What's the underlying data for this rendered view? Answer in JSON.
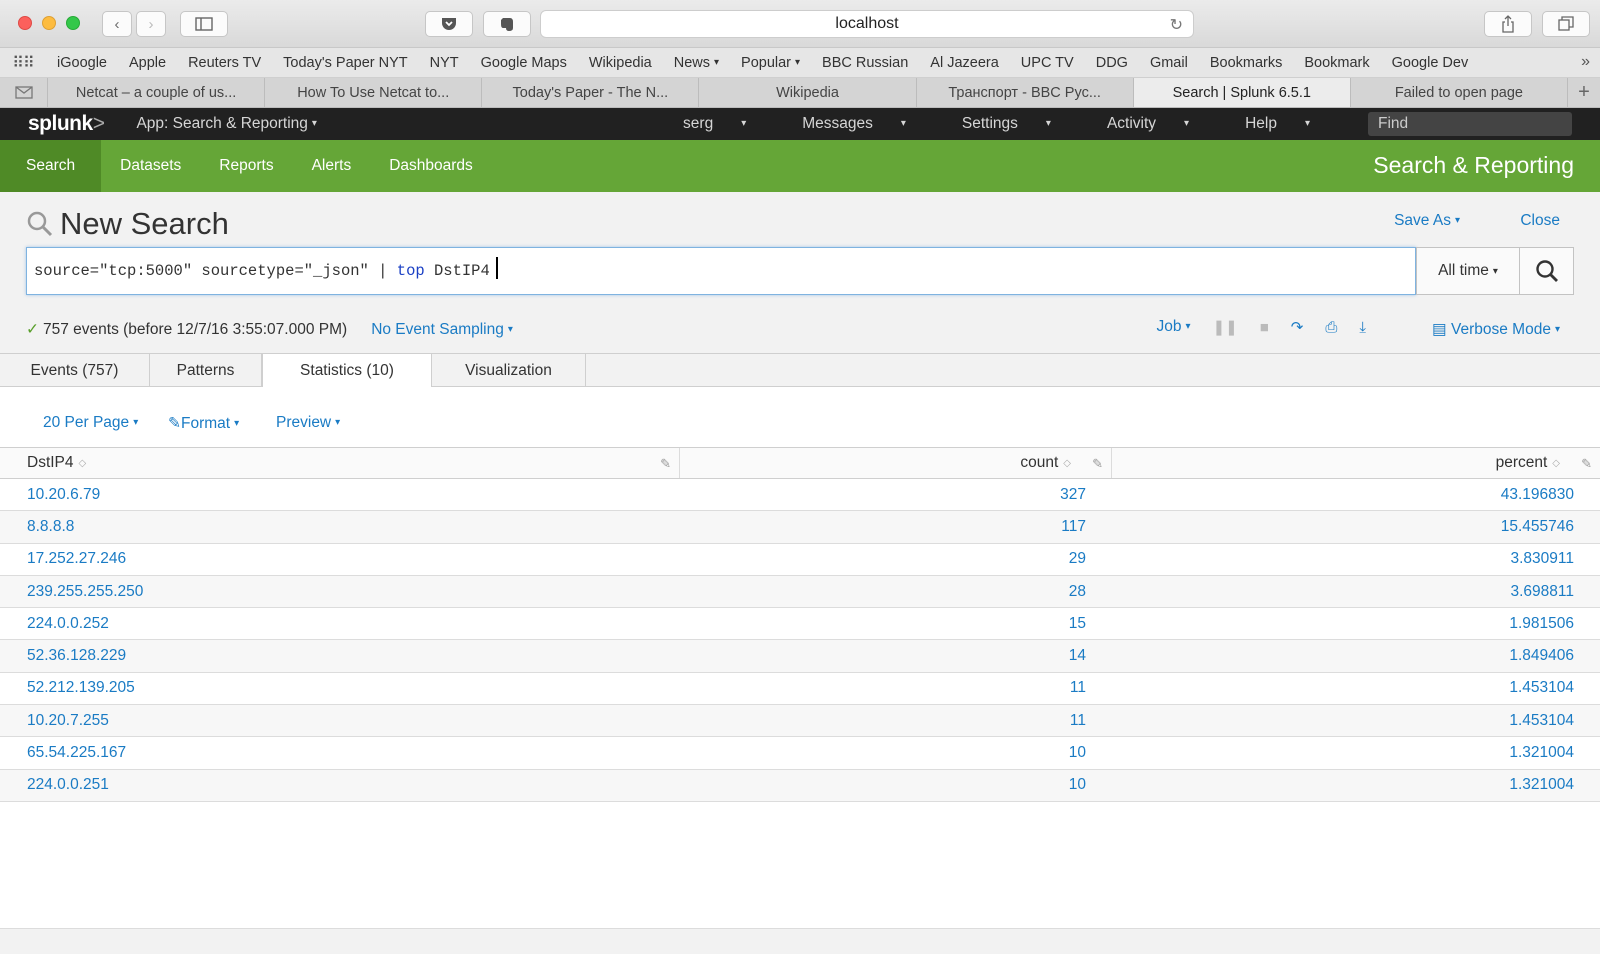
{
  "browser": {
    "url": "localhost",
    "bookmarks": [
      "iGoogle",
      "Apple",
      "Reuters TV",
      "Today's Paper NYT",
      "NYT",
      "Google Maps",
      "Wikipedia",
      "News",
      "Popular",
      "BBC Russian",
      "Al Jazeera",
      "UPC TV",
      "DDG",
      "Gmail",
      "Bookmarks",
      "Bookmark",
      "Google Dev"
    ],
    "tabs": [
      "Netcat – a couple of us...",
      "How To Use Netcat to...",
      "Today's Paper - The N...",
      "Wikipedia",
      "Транспорт - BBC Рус...",
      "Search | Splunk 6.5.1",
      "Failed to open page"
    ],
    "active_tab": 5
  },
  "splunkbar": {
    "logo": "splunk",
    "app": "App: Search & Reporting",
    "user": "serg",
    "messages": "Messages",
    "settings": "Settings",
    "activity": "Activity",
    "help": "Help",
    "find_placeholder": "Find"
  },
  "appnav": {
    "items": [
      "Search",
      "Datasets",
      "Reports",
      "Alerts",
      "Dashboards"
    ],
    "active": 0,
    "app_title": "Search & Reporting"
  },
  "search": {
    "title": "New Search",
    "save_as": "Save As",
    "close": "Close",
    "query_part1": "source=\"tcp:5000\" sourcetype=\"_json\" | ",
    "query_keyword": "top",
    "query_part2": " DstIP4",
    "time_range": "All time",
    "status": "757 events (before 12/7/16 3:55:07.000 PM)",
    "sampling": "No Event Sampling",
    "job": "Job",
    "mode": "Verbose Mode"
  },
  "result_tabs": [
    "Events (757)",
    "Patterns",
    "Statistics (10)",
    "Visualization"
  ],
  "active_result_tab": 2,
  "table_tools": {
    "per_page": "20 Per Page",
    "format": "Format",
    "preview": "Preview"
  },
  "table": {
    "columns": [
      "DstIP4",
      "count",
      "percent"
    ],
    "rows": [
      [
        "10.20.6.79",
        "327",
        "43.196830"
      ],
      [
        "8.8.8.8",
        "117",
        "15.455746"
      ],
      [
        "17.252.27.246",
        "29",
        "3.830911"
      ],
      [
        "239.255.255.250",
        "28",
        "3.698811"
      ],
      [
        "224.0.0.252",
        "15",
        "1.981506"
      ],
      [
        "52.36.128.229",
        "14",
        "1.849406"
      ],
      [
        "52.212.139.205",
        "11",
        "1.453104"
      ],
      [
        "10.20.7.255",
        "11",
        "1.453104"
      ],
      [
        "65.54.225.167",
        "10",
        "1.321004"
      ],
      [
        "224.0.0.251",
        "10",
        "1.321004"
      ]
    ]
  },
  "colors": {
    "accent_green": "#65a637",
    "link_blue": "#1a7bc4",
    "topbar": "#212121"
  }
}
